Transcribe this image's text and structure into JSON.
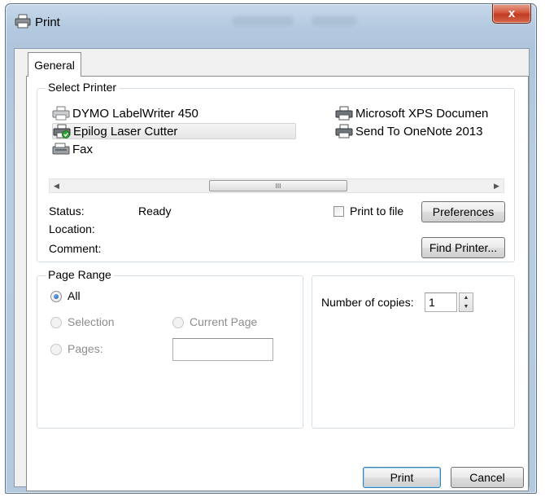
{
  "window": {
    "title": "Print",
    "close_label": "x"
  },
  "tabs": [
    {
      "label": "General"
    }
  ],
  "select_printer": {
    "legend": "Select Printer",
    "printers": [
      {
        "name": "DYMO LabelWriter 450",
        "icon": "printer-icon"
      },
      {
        "name": "Epilog Laser Cutter",
        "icon": "printer-default-icon",
        "selected": true
      },
      {
        "name": "Fax",
        "icon": "fax-icon"
      },
      {
        "name": "Microsoft XPS Documen",
        "icon": "printer-icon"
      },
      {
        "name": "Send To OneNote 2013",
        "icon": "printer-icon"
      }
    ],
    "scroll_grip": "III",
    "status_label": "Status:",
    "status_value": "Ready",
    "location_label": "Location:",
    "comment_label": "Comment:",
    "print_to_file_label": "Print to file",
    "print_to_file_checked": false,
    "preferences_label": "Preferences",
    "find_printer_label": "Find Printer..."
  },
  "page_range": {
    "legend": "Page Range",
    "options": [
      {
        "label": "All",
        "checked": true,
        "enabled": true
      },
      {
        "label": "Selection",
        "checked": false,
        "enabled": false
      },
      {
        "label": "Current Page",
        "checked": false,
        "enabled": false
      },
      {
        "label": "Pages:",
        "checked": false,
        "enabled": false
      }
    ],
    "pages_value": ""
  },
  "copies": {
    "label": "Number of copies:",
    "value": "1"
  },
  "buttons": {
    "print": "Print",
    "cancel": "Cancel"
  },
  "colors": {
    "accent_selection": "#1f5ba8",
    "titlebar": "#b3c9df",
    "close": "#c23b1f"
  }
}
